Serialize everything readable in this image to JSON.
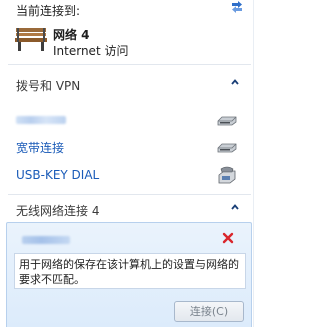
{
  "header": {
    "title": "当前连接到:",
    "network_name": "网络  4",
    "network_status": "Internet 访问"
  },
  "sections": {
    "dialup": {
      "label": "拨号和 VPN",
      "items": [
        {
          "label": "",
          "icon": "modem-icon"
        },
        {
          "label": "宽带连接",
          "icon": "modem-icon"
        },
        {
          "label": "USB-KEY DIAL",
          "icon": "phone-modem-icon"
        }
      ]
    },
    "wireless": {
      "label": "无线网络连接 4"
    }
  },
  "wifi_entry": {
    "message": "用于网络的保存在该计算机上的设置与网络的要求不匹配。",
    "connect_label": "连接(C)"
  },
  "colors": {
    "link": "#1a5bb8",
    "selection_bg": "#dcebfb",
    "close_red": "#d9262c"
  }
}
